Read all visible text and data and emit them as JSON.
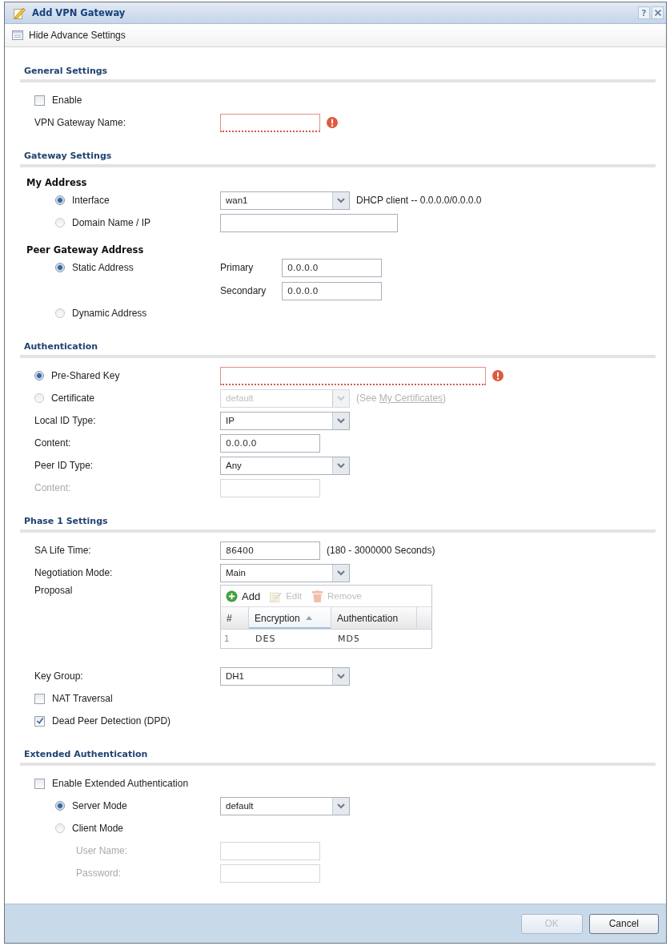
{
  "window": {
    "title": "Add VPN Gateway",
    "help_label": "?"
  },
  "toolbar": {
    "label": "Hide Advance Settings"
  },
  "sections": [
    {
      "title": "General Settings",
      "rows": [
        {
          "kind": "checkbox",
          "label": "Enable",
          "checked": false
        },
        {
          "kind": "field",
          "label": "VPN Gateway Name:",
          "control": {
            "kind": "text",
            "error": true
          }
        }
      ]
    },
    {
      "title": "Gateway Settings",
      "rows": [
        {
          "kind": "group",
          "title": "My Address",
          "children": [
            {
              "kind": "radio",
              "label": "Interface",
              "selected": true,
              "control": {
                "kind": "select",
                "value": "wan1"
              },
              "note": "DHCP client -- 0.0.0.0/0.0.0.0"
            },
            {
              "kind": "radio",
              "label": "Domain Name / IP",
              "selected": false,
              "control": {
                "kind": "text"
              }
            }
          ]
        },
        {
          "kind": "group",
          "title": "Peer Gateway Address",
          "children": [
            {
              "kind": "radio",
              "label": "Static Address",
              "selected": true,
              "control": {
                "kind": "pair",
                "fields": [
                  {
                    "label": "Primary",
                    "value": "0.0.0.0"
                  },
                  {
                    "label": "Secondary",
                    "value": "0.0.0.0"
                  }
                ]
              }
            },
            {
              "kind": "radio",
              "label": "Dynamic Address",
              "selected": false
            }
          ]
        }
      ]
    },
    {
      "title": "Authentication",
      "rows": [
        {
          "kind": "radio",
          "label": "Pre-Shared Key",
          "selected": true,
          "control": {
            "kind": "text",
            "error": true
          }
        },
        {
          "kind": "radio",
          "label": "Certificate",
          "selected": false,
          "control": {
            "kind": "select",
            "value": "default",
            "disabled": true
          },
          "note": "(See",
          "link": "My Certificates",
          "note_end": ")"
        },
        {
          "kind": "field",
          "label": "Local ID Type:",
          "control": {
            "kind": "select",
            "value": "IP"
          }
        },
        {
          "kind": "field",
          "label": "Content:",
          "control": {
            "kind": "text",
            "value": "0.0.0.0"
          }
        },
        {
          "kind": "field",
          "label": "Peer ID Type:",
          "control": {
            "kind": "select",
            "value": "Any"
          }
        },
        {
          "kind": "field",
          "label": "Content:",
          "disabled": true,
          "control": {
            "kind": "text",
            "disabled": true
          }
        }
      ]
    },
    {
      "title": "Phase 1 Settings",
      "rows": [
        {
          "kind": "field",
          "label": "SA Life Time:",
          "control": {
            "kind": "text",
            "value": "86400"
          },
          "note": "(180 - 3000000 Seconds)"
        },
        {
          "kind": "field",
          "label": "Negotiation Mode:",
          "control": {
            "kind": "select",
            "value": "Main"
          }
        },
        {
          "kind": "field",
          "label": "Proposal",
          "control": {
            "kind": "table",
            "actions": [
              {
                "kind": "add",
                "label": "Add",
                "disabled": false
              },
              {
                "kind": "edit",
                "label": "Edit",
                "disabled": true
              },
              {
                "kind": "remove",
                "label": "Remove",
                "disabled": true
              }
            ],
            "columns": [
              {
                "label": "#",
                "sorted": false
              },
              {
                "label": "Encryption",
                "sorted": true
              },
              {
                "label": "Authentication",
                "sorted": false
              }
            ],
            "rows": [
              [
                "1",
                "DES",
                "MD5"
              ]
            ]
          }
        },
        {
          "kind": "field",
          "label": "Key Group:",
          "control": {
            "kind": "select",
            "value": "DH1"
          }
        },
        {
          "kind": "checkbox",
          "label": "NAT Traversal",
          "checked": false
        },
        {
          "kind": "checkbox",
          "label": "Dead Peer Detection (DPD)",
          "checked": true
        }
      ]
    },
    {
      "title": "Extended Authentication",
      "rows": [
        {
          "kind": "checkbox",
          "label": "Enable Extended Authentication",
          "checked": false,
          "children": [
            {
              "kind": "radio",
              "label": "Server Mode",
              "selected": true,
              "control": {
                "kind": "select",
                "value": "default"
              }
            },
            {
              "kind": "radio",
              "label": "Client Mode",
              "selected": false,
              "children": [
                {
                  "kind": "field",
                  "label": "User Name:",
                  "disabled": true,
                  "control": {
                    "kind": "text",
                    "disabled": true
                  }
                },
                {
                  "kind": "field",
                  "label": "Password:",
                  "disabled": true,
                  "control": {
                    "kind": "text",
                    "disabled": true
                  }
                }
              ]
            }
          ]
        }
      ]
    }
  ],
  "buttons": [
    {
      "label": "OK",
      "disabled": true
    },
    {
      "label": "Cancel",
      "disabled": false
    }
  ]
}
